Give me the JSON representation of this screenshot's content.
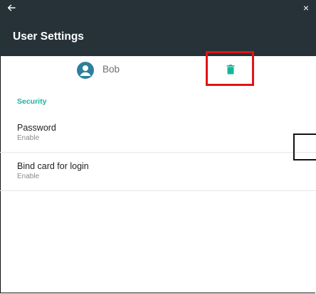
{
  "appbar": {
    "title": "User Settings",
    "back_icon": "arrow-left-icon",
    "close_glyph": "×",
    "background": "#263238"
  },
  "user": {
    "name": "Bob",
    "avatar_icon": "person-icon",
    "avatar_color": "#2d7f9b"
  },
  "delete_action": {
    "icon": "trash-icon",
    "color": "#16b59b",
    "highlight_color": "#e21313"
  },
  "section": {
    "header": "Security",
    "accent": "#16b59b"
  },
  "settings": [
    {
      "title": "Password",
      "subtitle": "Enable"
    },
    {
      "title": "Bind card for login",
      "subtitle": "Enable"
    }
  ]
}
